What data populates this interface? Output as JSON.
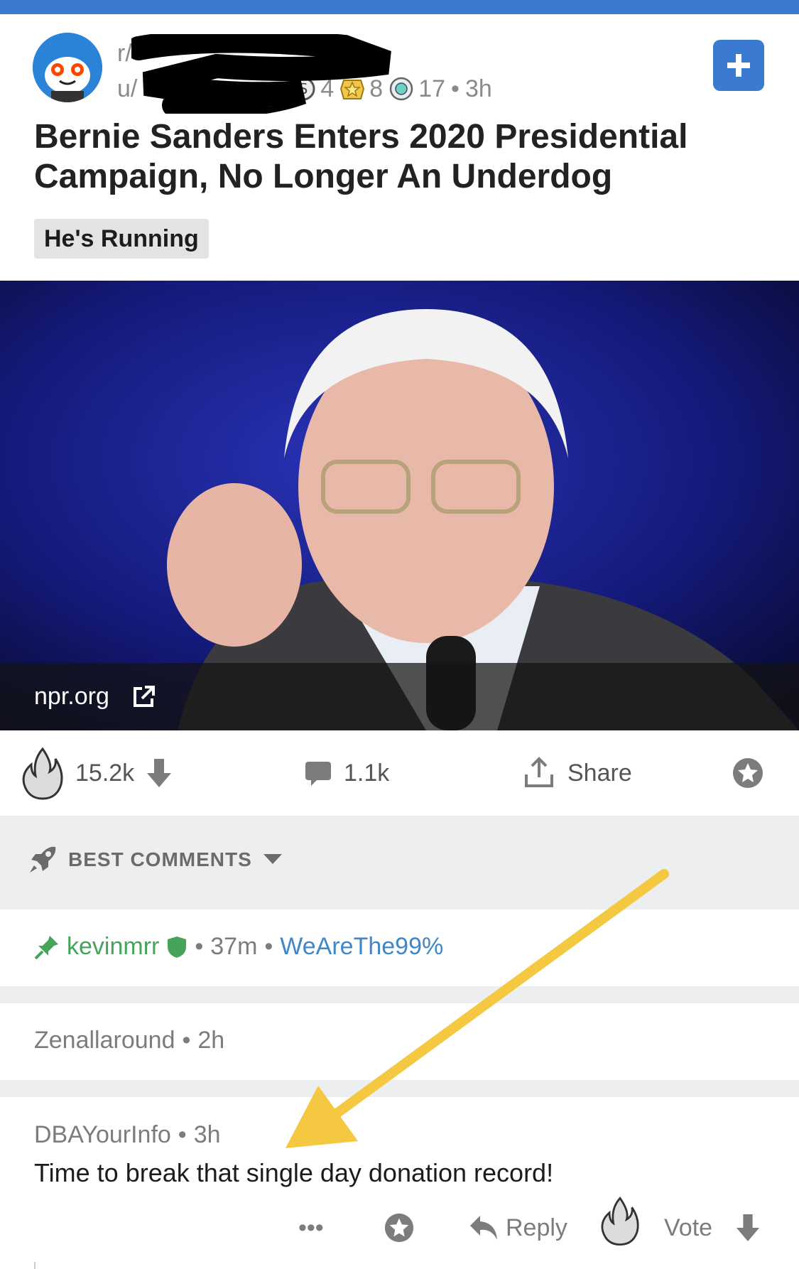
{
  "post": {
    "subreddit_prefix": "r/",
    "user_prefix": "u/",
    "awards": [
      {
        "icon": "silver-award-icon",
        "count": "4"
      },
      {
        "icon": "gold-award-icon",
        "count": "8"
      },
      {
        "icon": "platinum-award-icon",
        "count": "17"
      }
    ],
    "time": "3h",
    "title": "Bernie Sanders Enters 2020 Presidential Campaign, No Longer An Underdog",
    "flair": "He's Running",
    "link_domain": "npr.org",
    "upvotes": "15.2k",
    "comments": "1.1k",
    "share_label": "Share"
  },
  "sort": {
    "label": "BEST COMMENTS"
  },
  "comments": [
    {
      "author": "kevinmrr",
      "time": "37m",
      "flair": "WeAreThe99%"
    },
    {
      "author": "Zenallaround",
      "time": "2h"
    },
    {
      "author": "DBAYourInfo",
      "time": "3h",
      "body": "Time to break that single day donation record!",
      "reply_label": "Reply",
      "vote_label": "Vote",
      "more_label": "•••"
    }
  ],
  "colors": {
    "accent": "#3a7ad1",
    "mod_green": "#46a45a",
    "flair_blue": "#3f87c8",
    "annotation_arrow": "#f5c842"
  }
}
